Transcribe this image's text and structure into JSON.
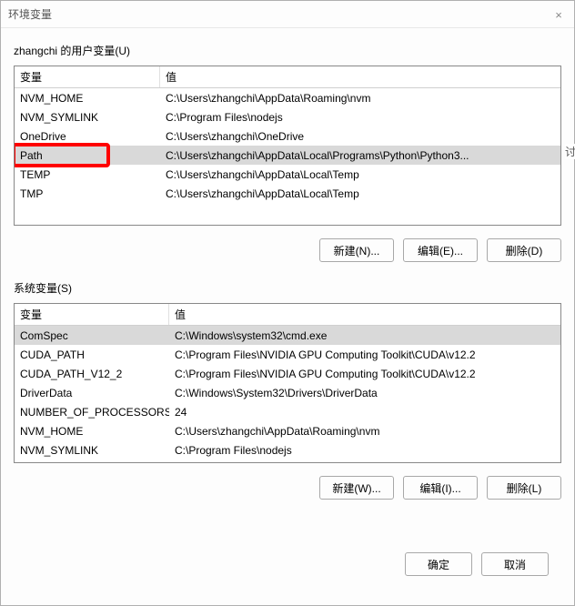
{
  "window": {
    "title": "环境变量",
    "close_icon": "×"
  },
  "side_text": "讨",
  "userVars": {
    "label": "zhangchi 的用户变量(U)",
    "header_name": "变量",
    "header_value": "值",
    "rows": [
      {
        "name": "NVM_HOME",
        "value": "C:\\Users\\zhangchi\\AppData\\Roaming\\nvm"
      },
      {
        "name": "NVM_SYMLINK",
        "value": "C:\\Program Files\\nodejs"
      },
      {
        "name": "OneDrive",
        "value": "C:\\Users\\zhangchi\\OneDrive"
      },
      {
        "name": "Path",
        "value": "C:\\Users\\zhangchi\\AppData\\Local\\Programs\\Python\\Python3..."
      },
      {
        "name": "TEMP",
        "value": "C:\\Users\\zhangchi\\AppData\\Local\\Temp"
      },
      {
        "name": "TMP",
        "value": "C:\\Users\\zhangchi\\AppData\\Local\\Temp"
      }
    ],
    "selected_index": 3,
    "highlight_index": 3,
    "buttons": {
      "new": "新建(N)...",
      "edit": "编辑(E)...",
      "delete": "删除(D)"
    }
  },
  "sysVars": {
    "label": "系统变量(S)",
    "header_name": "变量",
    "header_value": "值",
    "rows": [
      {
        "name": "ComSpec",
        "value": "C:\\Windows\\system32\\cmd.exe"
      },
      {
        "name": "CUDA_PATH",
        "value": "C:\\Program Files\\NVIDIA GPU Computing Toolkit\\CUDA\\v12.2"
      },
      {
        "name": "CUDA_PATH_V12_2",
        "value": "C:\\Program Files\\NVIDIA GPU Computing Toolkit\\CUDA\\v12.2"
      },
      {
        "name": "DriverData",
        "value": "C:\\Windows\\System32\\Drivers\\DriverData"
      },
      {
        "name": "NUMBER_OF_PROCESSORS",
        "value": "24"
      },
      {
        "name": "NVM_HOME",
        "value": "C:\\Users\\zhangchi\\AppData\\Roaming\\nvm"
      },
      {
        "name": "NVM_SYMLINK",
        "value": "C:\\Program Files\\nodejs"
      }
    ],
    "selected_index": 0,
    "buttons": {
      "new": "新建(W)...",
      "edit": "编辑(I)...",
      "delete": "删除(L)"
    }
  },
  "footer": {
    "ok": "确定",
    "cancel": "取消"
  }
}
